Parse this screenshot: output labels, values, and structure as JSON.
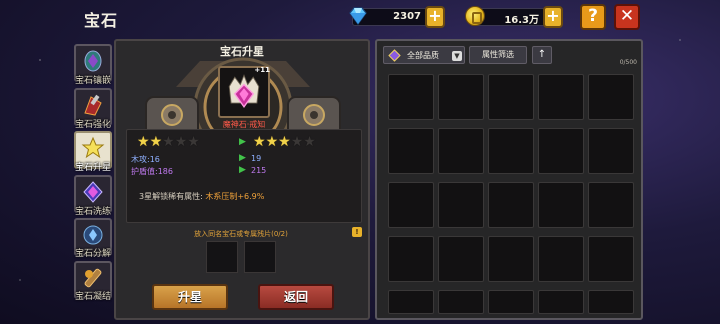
{
  "header": {
    "title": "宝石",
    "diamonds": "2307",
    "gold": "16.3万",
    "help_label": "?",
    "close_label": "✕",
    "plus_label": "+"
  },
  "sidebar": {
    "items": [
      {
        "label": "宝石镶嵌",
        "icon": "gem-socket-icon"
      },
      {
        "label": "宝石强化",
        "icon": "gem-enhance-icon"
      },
      {
        "label": "宝石升星",
        "icon": "star-upgrade-icon",
        "active": true
      },
      {
        "label": "宝石洗练",
        "icon": "gem-reforge-icon"
      },
      {
        "label": "宝石分解",
        "icon": "gem-decompose-icon"
      },
      {
        "label": "宝石凝结",
        "icon": "gem-condense-icon"
      }
    ]
  },
  "upgrade": {
    "title": "宝石升星",
    "gem_level": "+11",
    "gem_name": "魔神石·戒知",
    "current_stars": 2,
    "next_stars": 3,
    "max_stars": 5,
    "stats": [
      {
        "label": "木攻:16",
        "next": "19",
        "color": "#8fb0ff"
      },
      {
        "label": "护盾值:186",
        "next": "215",
        "color": "#c07af0"
      }
    ],
    "note_prefix": "3星解锁稀有属性:",
    "note_value": "木系压制+6.9%",
    "material_hint": "放入同名宝石或专属残片(0/2)",
    "info_badge": "!",
    "upgrade_button": "升星",
    "back_button": "返回"
  },
  "inventory": {
    "quality_filter": "全部品质",
    "attr_filter": "属性筛选",
    "sort_icon": "↑",
    "capacity": "0/500",
    "rows": 5,
    "cols": 5
  },
  "colors": {
    "accent_gold": "#e8b22a",
    "close_red": "#c8341e",
    "gem_name_red": "#ff5a4a",
    "highlight_orange": "#f0a23a"
  }
}
